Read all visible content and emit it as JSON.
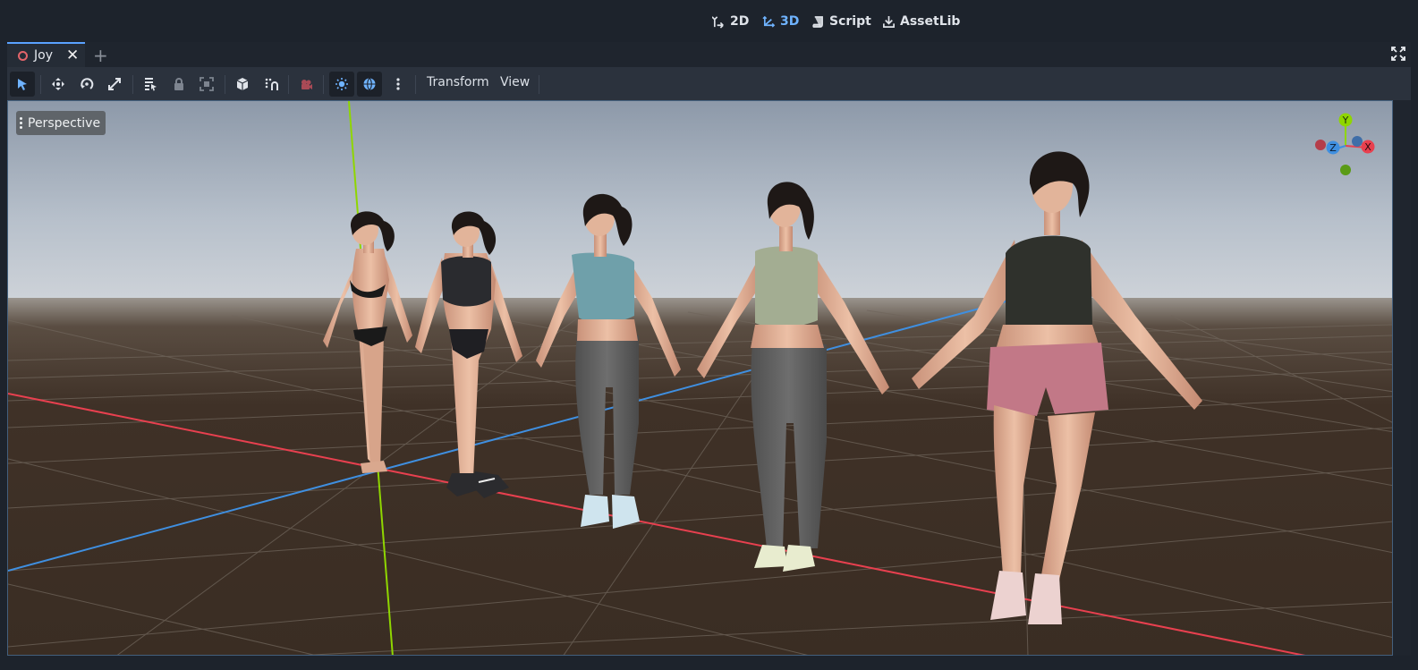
{
  "workspace_tabs": [
    {
      "label": "2D",
      "icon": "2d-icon",
      "active": false
    },
    {
      "label": "3D",
      "icon": "3d-icon",
      "active": true
    },
    {
      "label": "Script",
      "icon": "script-icon",
      "active": false
    },
    {
      "label": "AssetLib",
      "icon": "assetlib-icon",
      "active": false
    }
  ],
  "scene_tab": {
    "label": "Joy",
    "icon": "scene-ring-icon",
    "close": "✕"
  },
  "add_tab_label": "+",
  "toolbar": {
    "transform_menu": "Transform",
    "view_menu": "View"
  },
  "viewport": {
    "perspective_label": "Perspective",
    "gizmo": {
      "y": "Y",
      "z": "Z",
      "x": "X"
    }
  },
  "colors": {
    "accent": "#6fb3ff",
    "axis_x": "#e8404f",
    "axis_y": "#8fd600",
    "axis_z": "#3f8fe0",
    "floor": "#3d2f24",
    "sky_top": "#8e9aaa"
  }
}
